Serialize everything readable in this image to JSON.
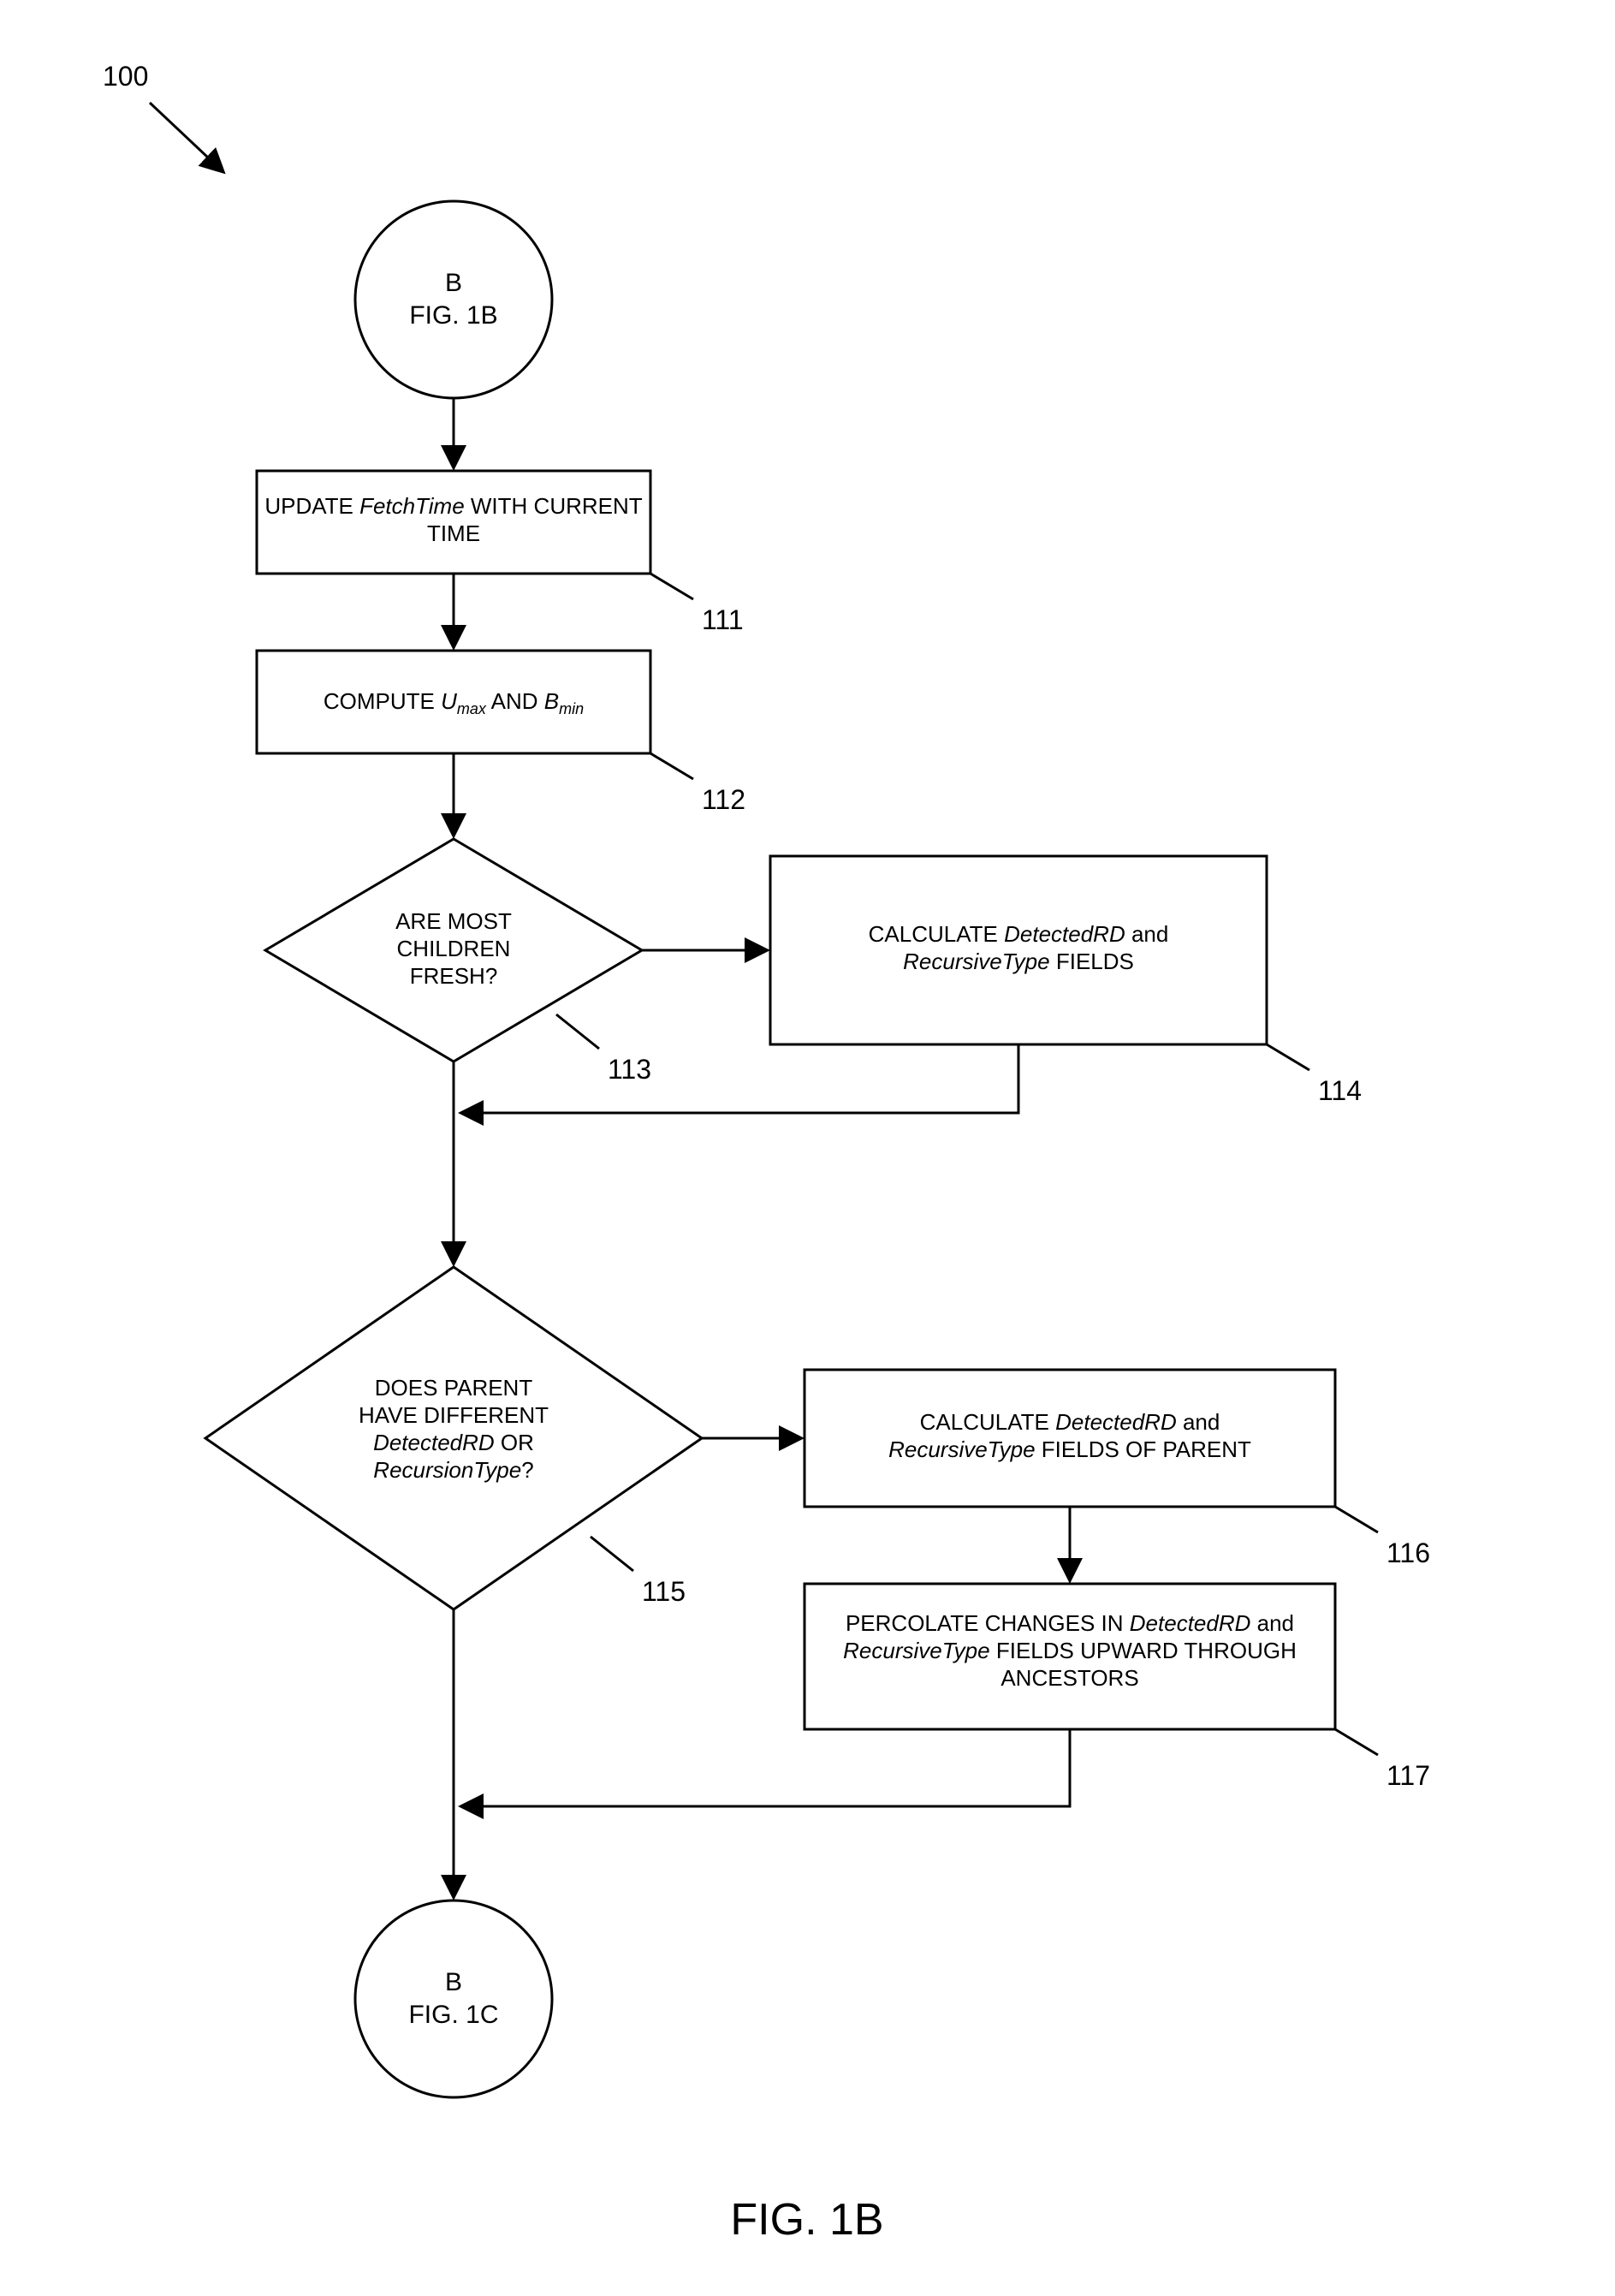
{
  "figure": {
    "number_label": "100",
    "caption": "FIG. 1B"
  },
  "nodes": {
    "circle_top": {
      "line1": "B",
      "line2": "FIG. 1B"
    },
    "circle_bottom": {
      "line1": "B",
      "line2": "FIG. 1C"
    },
    "box111": {
      "ref": "111",
      "line1_pre": "UPDATE ",
      "line1_it": "FetchTime",
      "line1_post": " WITH CURRENT",
      "line2": "TIME"
    },
    "box112": {
      "ref": "112",
      "pre": "COMPUTE ",
      "u_it": "U",
      "u_sub": "max",
      "mid": " AND ",
      "b_it": "B",
      "b_sub": "min"
    },
    "diamond113": {
      "ref": "113",
      "line1": "ARE MOST",
      "line2": "CHILDREN",
      "line3": "FRESH?"
    },
    "box114": {
      "ref": "114",
      "line1_pre": "CALCULATE ",
      "line1_it": "DetectedRD",
      "line1_post": " and",
      "line2_it": "RecursiveType",
      "line2_post": " FIELDS"
    },
    "diamond115": {
      "ref": "115",
      "line1": "DOES PARENT",
      "line2": "HAVE DIFFERENT",
      "line3_it": "DetectedRD",
      "line3_post": " OR",
      "line4_it": "RecursionType",
      "line4_post": "?"
    },
    "box116": {
      "ref": "116",
      "line1_pre": "CALCULATE ",
      "line1_it": "DetectedRD",
      "line1_post": " and",
      "line2_it": "RecursiveType",
      "line2_post": " FIELDS OF PARENT"
    },
    "box117": {
      "ref": "117",
      "line1_pre": "PERCOLATE CHANGES IN ",
      "line1_it": "DetectedRD",
      "line1_post": " and",
      "line2_it": "RecursiveType",
      "line2_post": " FIELDS UPWARD THROUGH",
      "line3": "ANCESTORS"
    }
  }
}
